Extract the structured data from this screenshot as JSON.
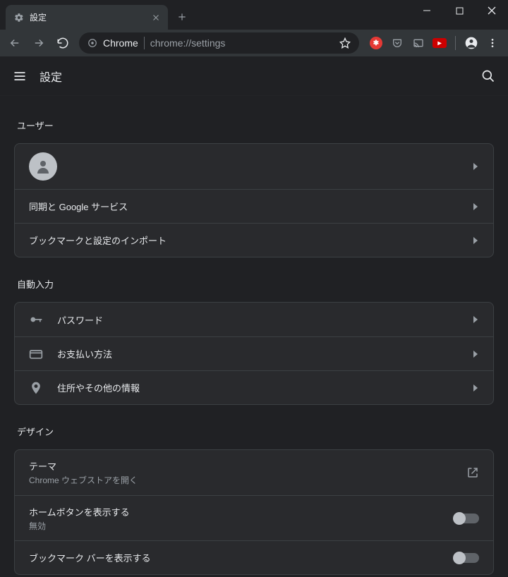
{
  "window": {
    "tab_title": "設定",
    "url_prefix": "Chrome",
    "url": "chrome://settings"
  },
  "header": {
    "title": "設定"
  },
  "sections": {
    "user": {
      "title": "ユーザー",
      "rows": {
        "sync": "同期と Google サービス",
        "import": "ブックマークと設定のインポート"
      }
    },
    "autofill": {
      "title": "自動入力",
      "rows": {
        "passwords": "パスワード",
        "payment": "お支払い方法",
        "addresses": "住所やその他の情報"
      }
    },
    "design": {
      "title": "デザイン",
      "rows": {
        "theme": {
          "label": "テーマ",
          "sub": "Chrome ウェブストアを開く"
        },
        "home": {
          "label": "ホームボタンを表示する",
          "sub": "無効"
        },
        "bookmarks": {
          "label": "ブックマーク バーを表示する"
        }
      }
    }
  }
}
